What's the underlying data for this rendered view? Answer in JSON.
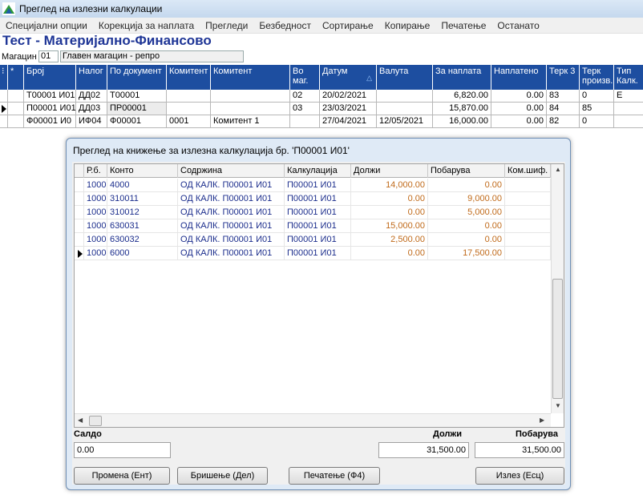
{
  "window": {
    "title": "Преглед на излезни калкулации"
  },
  "menu": [
    "Специјални опции",
    "Корекција за наплата",
    "Прегледи",
    "Безбедност",
    "Сортирање",
    "Копирање",
    "Печатење",
    "Останато"
  ],
  "heading": "Тест - Материјално-Финансово",
  "warehouse": {
    "label": "Магацин",
    "code": "01",
    "name": "Главен магацин - репро"
  },
  "main_grid": {
    "columns": [
      "*",
      "Број",
      "Налог",
      "По документ",
      "Комитент",
      "Комитент",
      "Во маг.",
      "Датум",
      "Валута",
      "За наплата",
      "Наплатено",
      "Терк 3",
      "Терк произв.",
      "Тип Калк."
    ],
    "rows": [
      [
        "",
        "Т00001 И01",
        "ДД02",
        "Т00001",
        "",
        "",
        "02",
        "20/02/2021",
        "",
        "6,820.00",
        "0.00",
        "83",
        "0",
        "Е"
      ],
      [
        "",
        "П00001 И01",
        "ДД03",
        "ПР00001",
        "",
        "",
        "03",
        "23/03/2021",
        "",
        "15,870.00",
        "0.00",
        "84",
        "85",
        ""
      ],
      [
        "",
        "Ф00001 И0",
        "ИФ04",
        "Ф00001",
        "0001",
        "Комитент 1",
        "",
        "27/04/2021",
        "12/05/2021",
        "16,000.00",
        "0.00",
        "82",
        "0",
        ""
      ]
    ]
  },
  "dialog": {
    "title": "Преглед на книжење за излезна калкулација бр. 'П00001 И01'",
    "columns": [
      "Р.б.",
      "Конто",
      "Содржина",
      "Калкулација",
      "Должи",
      "Побарува",
      "Ком.шиф."
    ],
    "rows": [
      [
        "1000",
        "4000",
        "ОД КАЛК. П00001 И01",
        "П00001 И01",
        "14,000.00",
        "0.00",
        ""
      ],
      [
        "1000",
        "310011",
        "ОД КАЛК. П00001 И01",
        "П00001 И01",
        "0.00",
        "9,000.00",
        ""
      ],
      [
        "1000",
        "310012",
        "ОД КАЛК. П00001 И01",
        "П00001 И01",
        "0.00",
        "5,000.00",
        ""
      ],
      [
        "1000",
        "630031",
        "ОД КАЛК. П00001 И01",
        "П00001 И01",
        "15,000.00",
        "0.00",
        ""
      ],
      [
        "1000",
        "630032",
        "ОД КАЛК. П00001 И01",
        "П00001 И01",
        "2,500.00",
        "0.00",
        ""
      ],
      [
        "1000",
        "6000",
        "ОД КАЛК. П00001 И01",
        "П00001 И01",
        "0.00",
        "17,500.00",
        ""
      ]
    ],
    "saldo_label": "Салдо",
    "saldo_value": "0.00",
    "debit_label": "Должи",
    "debit_value": "31,500.00",
    "credit_label": "Побарува",
    "credit_value": "31,500.00",
    "buttons": {
      "edit": "Промена (Ент)",
      "delete": "Бришење (Дел)",
      "print": "Печатење (Ф4)",
      "exit": "Излез (Есц)"
    }
  },
  "colors": {
    "header_blue": "#1d4ea0",
    "heading": "#1e3596",
    "amount": "#c06a1a",
    "text_blue": "#1b2d8c"
  }
}
